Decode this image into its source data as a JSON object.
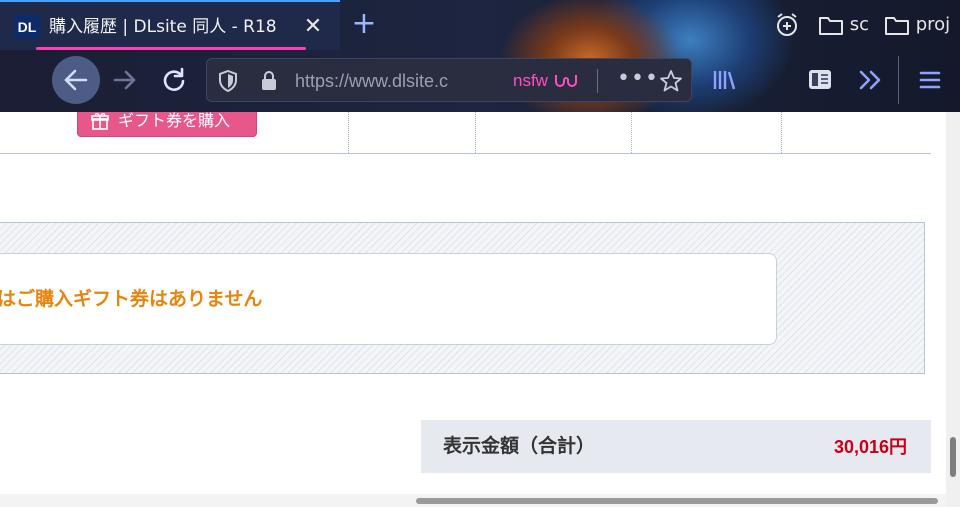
{
  "browser": {
    "tab": {
      "favicon_text": "DL",
      "title": "購入履歴 | DLsite 同人 - R18",
      "close_icon": "close-icon",
      "accent_color": "#ff3fb4"
    },
    "new_tab_icon": "plus-icon",
    "bookmarks": [
      {
        "icon": "alarm-add-icon",
        "label": ""
      },
      {
        "icon": "folder-icon",
        "label": "sc"
      },
      {
        "icon": "folder-icon",
        "label": "proj"
      }
    ],
    "url": {
      "text": "https://www.dlsite.c",
      "tag": "nsfw"
    }
  },
  "page": {
    "gift_button_label": "ギフト券を購入",
    "gift_empty_message": "ではご購入ギフト券はありません",
    "total": {
      "label": "表示金額（合計）",
      "value": "30,016円",
      "value_color": "#c8001a"
    },
    "message_color": "#e8850e"
  }
}
